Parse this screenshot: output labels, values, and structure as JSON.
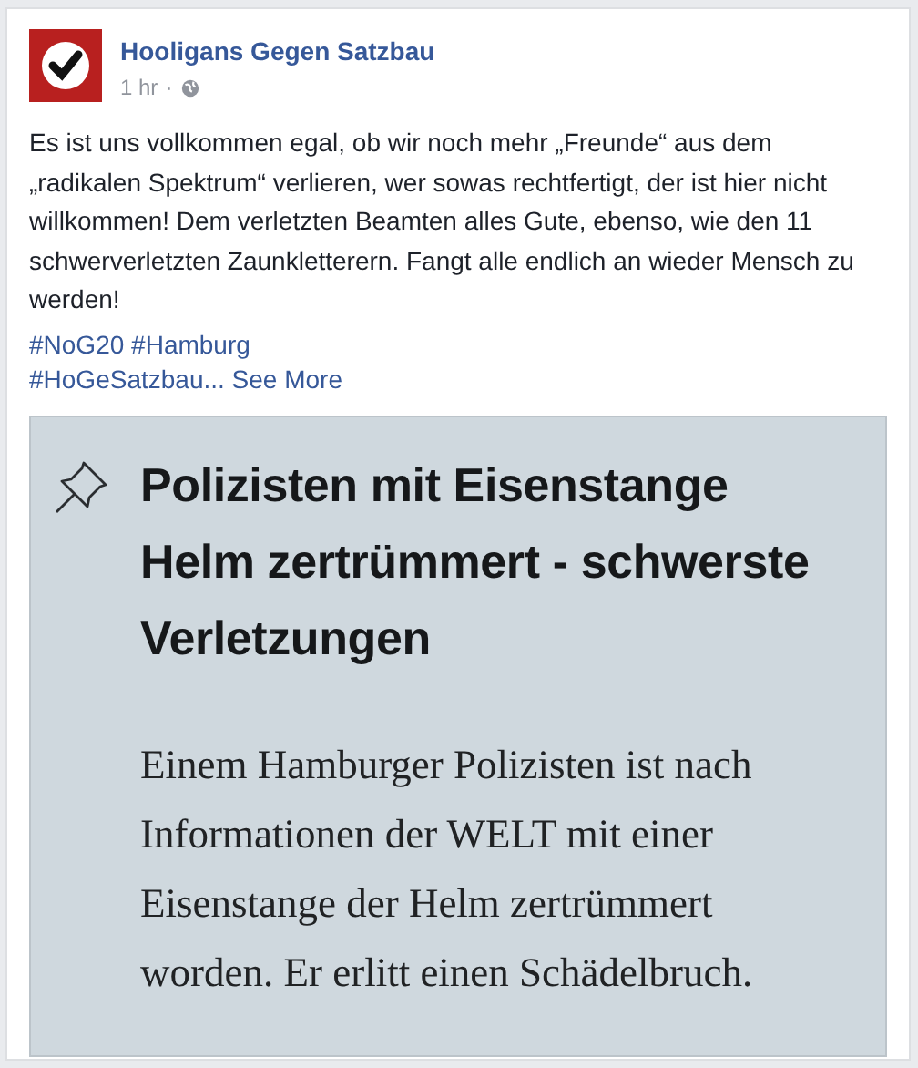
{
  "post": {
    "author": "Hooligans Gegen Satzbau",
    "time": "1 hr",
    "separator": "·",
    "text": "Es ist uns vollkommen egal, ob wir noch mehr „Freunde“ aus dem „radikalen Spektrum“ verlieren, wer sowas rechtfertigt, der ist hier nicht willkommen! Dem verletzten Beamten alles Gute, ebenso, wie den 11 schwerverletzten Zaunkletterern. Fangt alle endlich an wieder Mensch zu werden!",
    "hashtags": [
      "#NoG20",
      "#Hamburg",
      "#HoGeSatzbau..."
    ],
    "see_more": "See More",
    "shared_image": {
      "headline": "Polizisten mit Eisenstange Helm zertrümmert - schwerste Verletzungen",
      "body": "Einem Hamburger Polizisten ist nach Informationen der WELT mit einer Eisenstange der Helm zertrümmert worden. Er erlitt einen Schädelbruch."
    }
  }
}
